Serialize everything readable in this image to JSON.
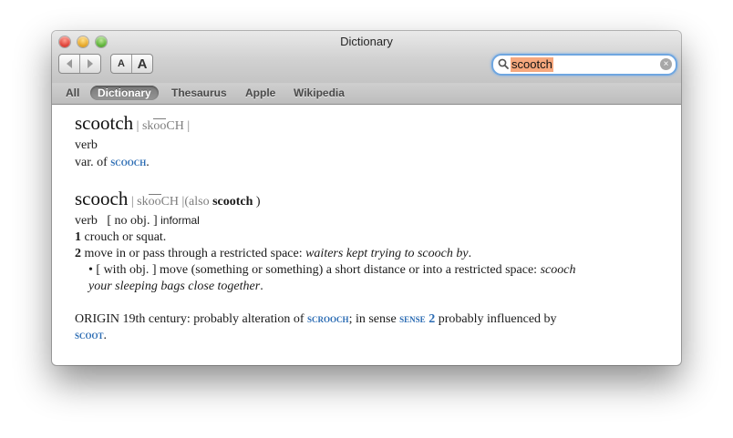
{
  "window": {
    "title": "Dictionary"
  },
  "toolbar": {
    "back_icon": "back-arrow-icon",
    "forward_icon": "forward-arrow-icon",
    "font_smaller_label": "A",
    "font_larger_label": "A",
    "search": {
      "value": "scootch",
      "icon": "magnifier-icon",
      "clear_icon": "clear-icon"
    }
  },
  "tabs": [
    {
      "label": "All",
      "active": false
    },
    {
      "label": "Dictionary",
      "active": true
    },
    {
      "label": "Thesaurus",
      "active": false
    },
    {
      "label": "Apple",
      "active": false
    },
    {
      "label": "Wikipedia",
      "active": false
    }
  ],
  "entry1": {
    "headword": "scootch",
    "pron_bar1": "|",
    "pron_pre": "sk",
    "pron_mid": "oo",
    "pron_post": "CH",
    "pron_bar2": "|",
    "pos": "verb",
    "variant_prefix": "var. of",
    "variant_link": "scooch",
    "variant_suffix": "."
  },
  "entry2": {
    "headword": "scooch",
    "pron_bar1": "|",
    "pron_pre": "sk",
    "pron_mid": "oo",
    "pron_post": "CH",
    "pron_bar2": "|(also",
    "also_word": "scootch",
    "also_close": ")",
    "pos": "verb",
    "grammar": "[ no obj. ]",
    "register": "informal",
    "sense1_num": "1",
    "sense1_text": "crouch or squat.",
    "sense2_num": "2",
    "sense2_text": "move in or pass through a restricted space:",
    "sense2_example": "waiters kept trying to scooch by",
    "sense2_end": ".",
    "subsense_bullet": "•",
    "subsense_grammar": "[ with obj. ]",
    "subsense_text": "move (something or something) a short distance or into a restricted space:",
    "subsense_example_a": "scooch",
    "subsense_example_b": "your sleeping bags close together",
    "subsense_end": ".",
    "origin_text": "ORIGIN 19th century: probably alteration of",
    "origin_link1": "scrooch",
    "origin_mid": "; in sense",
    "origin_link2": "sense",
    "origin_link2_num": "2",
    "origin_tail": "probably influenced by",
    "origin_link3": "scoot",
    "origin_end": "."
  }
}
